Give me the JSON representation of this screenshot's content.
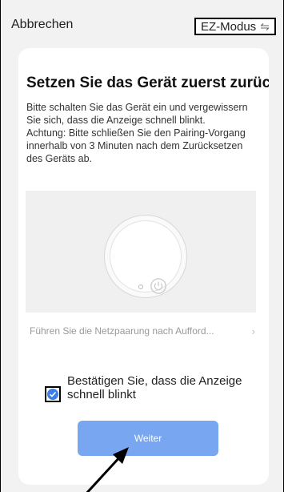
{
  "header": {
    "cancel_label": "Abbrechen",
    "mode_label": "EZ-Modus",
    "mode_icon": "swap-arrows-icon"
  },
  "main": {
    "title": "Setzen Sie das Gerät zuerst zurück",
    "description_lines": [
      "Bitte schalten Sie das Gerät ein und vergewissern Sie sich, dass die Anzeige schnell blinkt.",
      "Achtung: Bitte schließen Sie den Pairing-Vorgang innerhalb von 3 Minuten nach dem Zurücksetzen des Geräts ab."
    ],
    "illustration_icon": "device-power-icon",
    "pair_link_label": "Führen Sie die Netzpaarung nach Aufford...",
    "confirm_label": "Bestätigen Sie, dass die Anzeige schnell blinkt",
    "confirm_checked": true,
    "next_button_label": "Weiter"
  },
  "colors": {
    "accent": "#3d7fe8",
    "button": "#78a6f0",
    "background": "#f2f2f2"
  }
}
